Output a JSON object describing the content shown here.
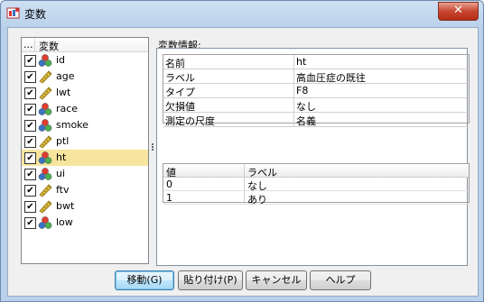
{
  "window": {
    "title": "変数",
    "close_glyph": "✕"
  },
  "variable_list": {
    "header_dots": "...",
    "header_label": "変数",
    "items": [
      {
        "name": "id",
        "type": "nominal",
        "checked": true,
        "selected": false
      },
      {
        "name": "age",
        "type": "scale",
        "checked": true,
        "selected": false
      },
      {
        "name": "lwt",
        "type": "scale",
        "checked": true,
        "selected": false
      },
      {
        "name": "race",
        "type": "nominal",
        "checked": true,
        "selected": false
      },
      {
        "name": "smoke",
        "type": "nominal",
        "checked": true,
        "selected": false
      },
      {
        "name": "ptl",
        "type": "scale",
        "checked": true,
        "selected": false
      },
      {
        "name": "ht",
        "type": "nominal",
        "checked": true,
        "selected": true
      },
      {
        "name": "ui",
        "type": "nominal",
        "checked": true,
        "selected": false
      },
      {
        "name": "ftv",
        "type": "scale",
        "checked": true,
        "selected": false
      },
      {
        "name": "bwt",
        "type": "scale",
        "checked": true,
        "selected": false
      },
      {
        "name": "low",
        "type": "nominal",
        "checked": true,
        "selected": false
      }
    ],
    "check_glyph": "✔"
  },
  "info": {
    "label": "変数情報:",
    "properties": [
      {
        "key": "名前",
        "value": "ht"
      },
      {
        "key": "ラベル",
        "value": "高血圧症の既往"
      },
      {
        "key": "タイプ",
        "value": "F8"
      },
      {
        "key": "欠損値",
        "value": "なし"
      },
      {
        "key": "測定の尺度",
        "value": "名義"
      }
    ],
    "value_labels": {
      "headers": {
        "value": "値",
        "label": "ラベル"
      },
      "rows": [
        {
          "value": "0",
          "label": "なし"
        },
        {
          "value": "1",
          "label": "あり"
        }
      ]
    }
  },
  "buttons": {
    "goto": "移動(G)",
    "paste": "貼り付け(P)",
    "cancel": "キャンセル",
    "help": "ヘルプ"
  },
  "colors": {
    "selection": "#f7e59e",
    "nominal_icon": [
      "#e03c31",
      "#3b73c4",
      "#4caf50"
    ],
    "scale_icon": "#e2c044"
  }
}
